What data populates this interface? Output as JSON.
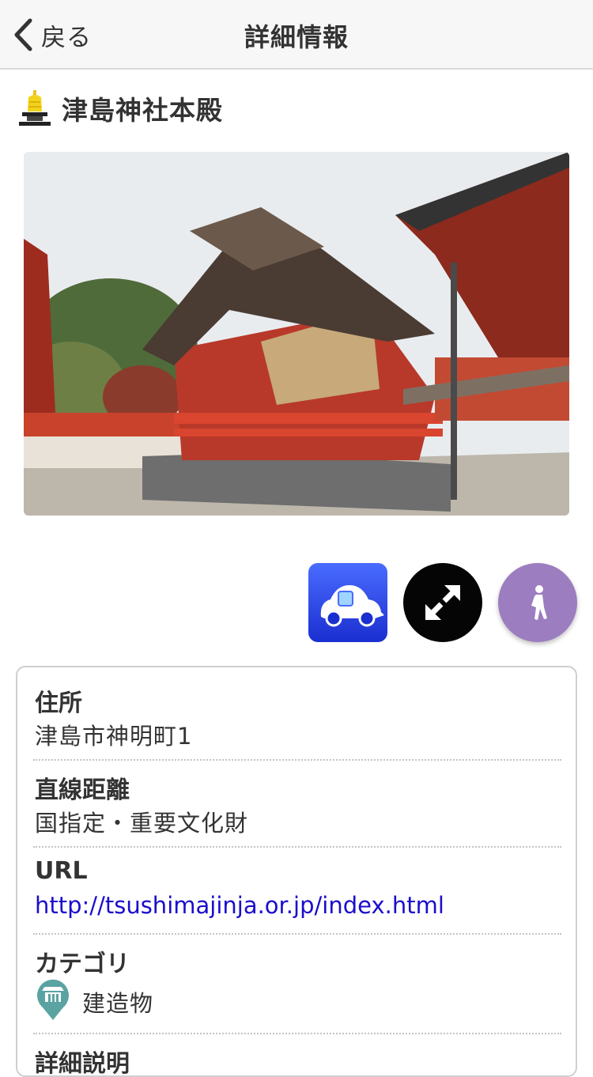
{
  "navbar": {
    "back_label": "戻る",
    "title": "詳細情報"
  },
  "place": {
    "icon": "temple-bell-icon",
    "name": "津島神社本殿"
  },
  "actions": [
    {
      "name": "car-navigation",
      "icon": "car-icon"
    },
    {
      "name": "expand",
      "icon": "expand-arrows-icon"
    },
    {
      "name": "walking-navigation",
      "icon": "pedestrian-icon"
    }
  ],
  "details": {
    "address_label": "住所",
    "address_value": "津島市神明町1",
    "distance_label": "直線距離",
    "distance_value": "国指定・重要文化財",
    "url_label": "URL",
    "url_value": "http://tsushimajinja.or.jp/index.html",
    "category_label": "カテゴリ",
    "category_value": "建造物",
    "category_icon": "building-pin-icon",
    "description_label": "詳細説明"
  },
  "colors": {
    "link": "#1a0dcc",
    "car_button": "#2a45e6",
    "expand_button": "#050505",
    "walk_button": "#9c7dc0",
    "category_pin": "#5ba3a3"
  }
}
